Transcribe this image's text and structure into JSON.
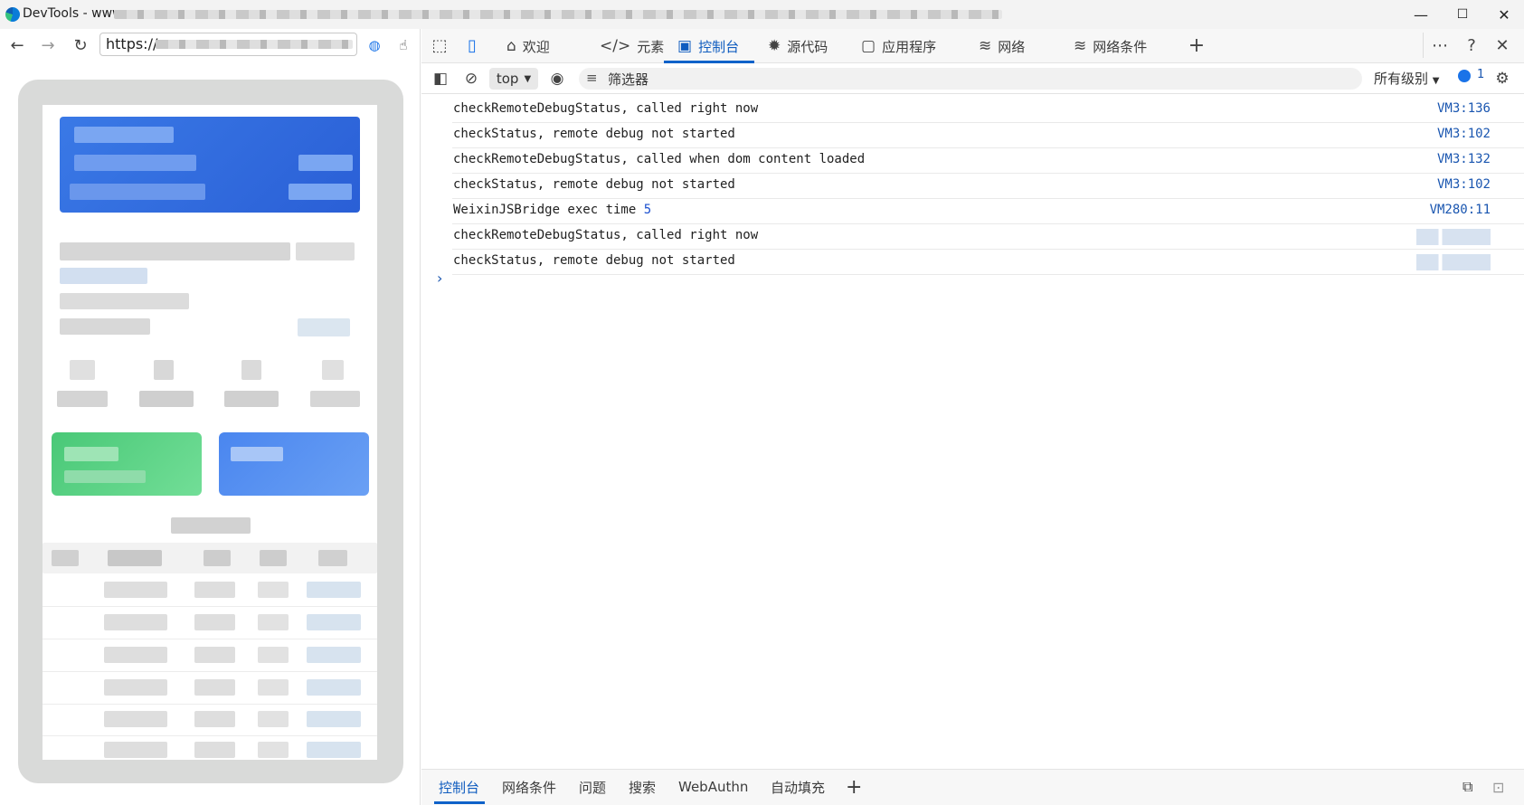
{
  "window": {
    "title": "DevTools - www.",
    "controls": [
      "—",
      "☐",
      "✕"
    ]
  },
  "left_pane": {
    "url": "https://"
  },
  "devtools": {
    "tabs": [
      {
        "label": "欢迎",
        "icon": "home-icon"
      },
      {
        "label": "元素",
        "icon": "code-icon"
      },
      {
        "label": "控制台",
        "icon": "console-icon",
        "active": true
      },
      {
        "label": "源代码",
        "icon": "bug-icon"
      },
      {
        "label": "应用程序",
        "icon": "app-icon"
      },
      {
        "label": "网络",
        "icon": "wifi-icon"
      },
      {
        "label": "网络条件",
        "icon": "network-conditions-icon"
      }
    ],
    "toolbar": {
      "context": "top",
      "filter_placeholder": "筛选器",
      "levels": "所有级别",
      "message_count": "1"
    },
    "console": [
      {
        "message": "checkRemoteDebugStatus, called right now",
        "source": "VM3:136"
      },
      {
        "message": "checkStatus, remote debug not started",
        "source": "VM3:102"
      },
      {
        "message": "checkRemoteDebugStatus, called when dom content loaded",
        "source": "VM3:132"
      },
      {
        "message": "checkStatus, remote debug not started",
        "source": "VM3:102"
      },
      {
        "message": "WeixinJSBridge exec time ",
        "number": "5",
        "source": "VM280:11"
      },
      {
        "message": "checkRemoteDebugStatus, called right now",
        "source": ""
      },
      {
        "message": "checkStatus, remote debug not started",
        "source": ""
      }
    ],
    "prompt": "›",
    "drawer_tabs": [
      {
        "label": "控制台",
        "active": true
      },
      {
        "label": "网络条件"
      },
      {
        "label": "问题"
      },
      {
        "label": "搜索"
      },
      {
        "label": "WebAuthn"
      },
      {
        "label": "自动填充"
      }
    ]
  },
  "colors": {
    "accent": "#0f5cbf",
    "link": "#1a56b0",
    "banner_blue": "#2f6fe0",
    "card_green": "#5fd484",
    "card_blue": "#4a86ef"
  }
}
